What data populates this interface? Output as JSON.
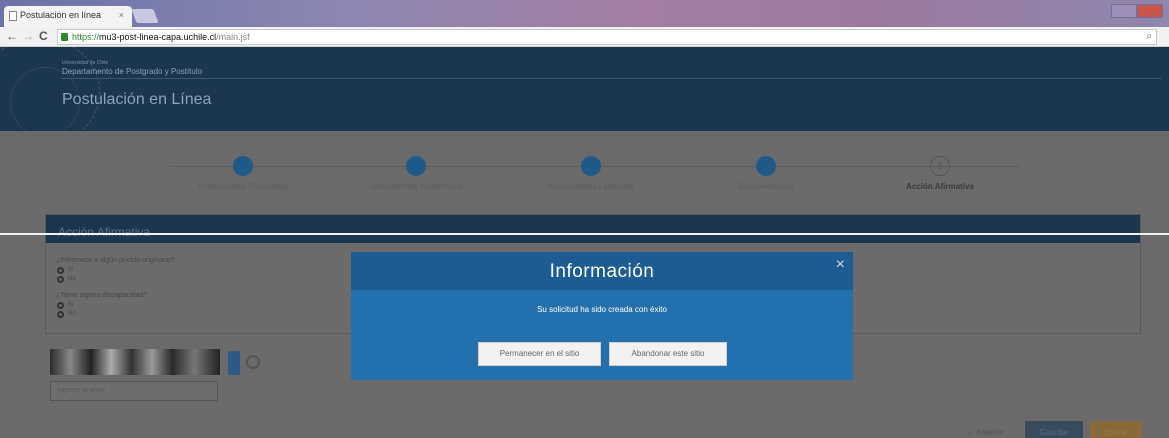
{
  "browser": {
    "tab_title": "Postulación en línea",
    "tab_close": "×",
    "url_scheme": "https://",
    "url_host": "mu3-post-linea-capa.uchile.cl",
    "url_path": "/main.jsf",
    "back": "←",
    "forward": "→",
    "reload": "C"
  },
  "header": {
    "university": "Universidad de Chile",
    "department": "Departamento de Postgrado y Postítulo",
    "title": "Postulación en Línea"
  },
  "steps": [
    {
      "label": "Antecedentes Personales"
    },
    {
      "label": "Antecedentes Académicos"
    },
    {
      "label": "Antecedentes Laborales"
    },
    {
      "label": "Documentación"
    },
    {
      "label": "Acción Afirmativa",
      "number": "5"
    }
  ],
  "panel": {
    "title": "Acción Afirmativa",
    "q1": "¿Pertenece a algún pueblo originario?",
    "q1_opt1": "Sí",
    "q1_opt2": "No",
    "q2": "¿Tiene alguna discapacidad?",
    "q2_opt1": "Sí",
    "q2_opt2": "No"
  },
  "captcha": {
    "placeholder": "Ingrese el texto"
  },
  "footer": {
    "back_label": "← Anterior",
    "save_label": "Guardar",
    "send_label": "Enviar"
  },
  "modal": {
    "title": "Información",
    "close": "×",
    "message": "Su solicitud ha sido creada con éxito",
    "stay_label": "Permanecer en el sitio",
    "leave_label": "Abandonar este sitio"
  },
  "colors": {
    "header_bg": "#1c3550",
    "modal_bg": "#2470ad",
    "modal_head": "#1e5d93"
  }
}
